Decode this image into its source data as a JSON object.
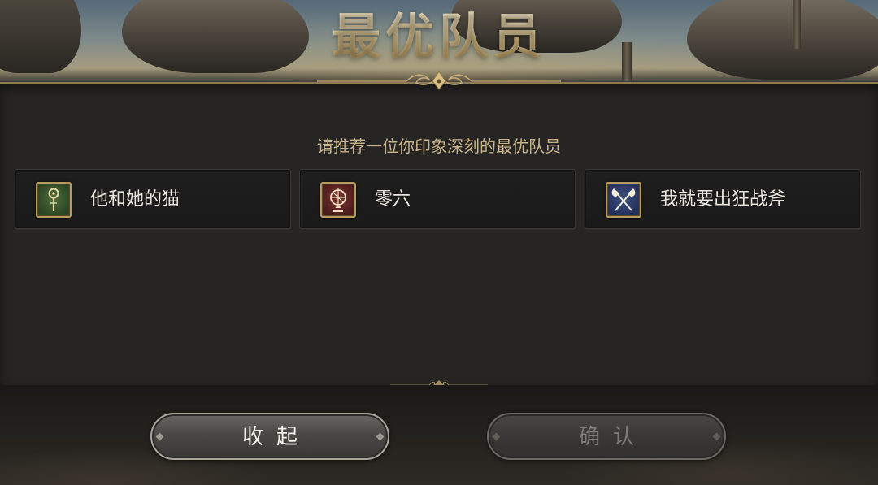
{
  "screen": {
    "title": "最优队员",
    "prompt": "请推荐一位你印象深刻的最优队员"
  },
  "options": [
    {
      "name": "他和她的猫",
      "icon": "staff-icon",
      "badge_color": "#2c4424"
    },
    {
      "name": "零六",
      "icon": "astrolabe-icon",
      "badge_color": "#4a1c1c"
    },
    {
      "name": "我就要出狂战斧",
      "icon": "crossed-axes-icon",
      "badge_color": "#24305a"
    }
  ],
  "buttons": {
    "collapse": "收起",
    "confirm": "确认",
    "confirm_enabled": false
  },
  "colors": {
    "title_gold": "#e6d3a2",
    "prompt_gold": "#c9b38a",
    "panel": "#262524",
    "frame_gold": "#b79a5e"
  }
}
